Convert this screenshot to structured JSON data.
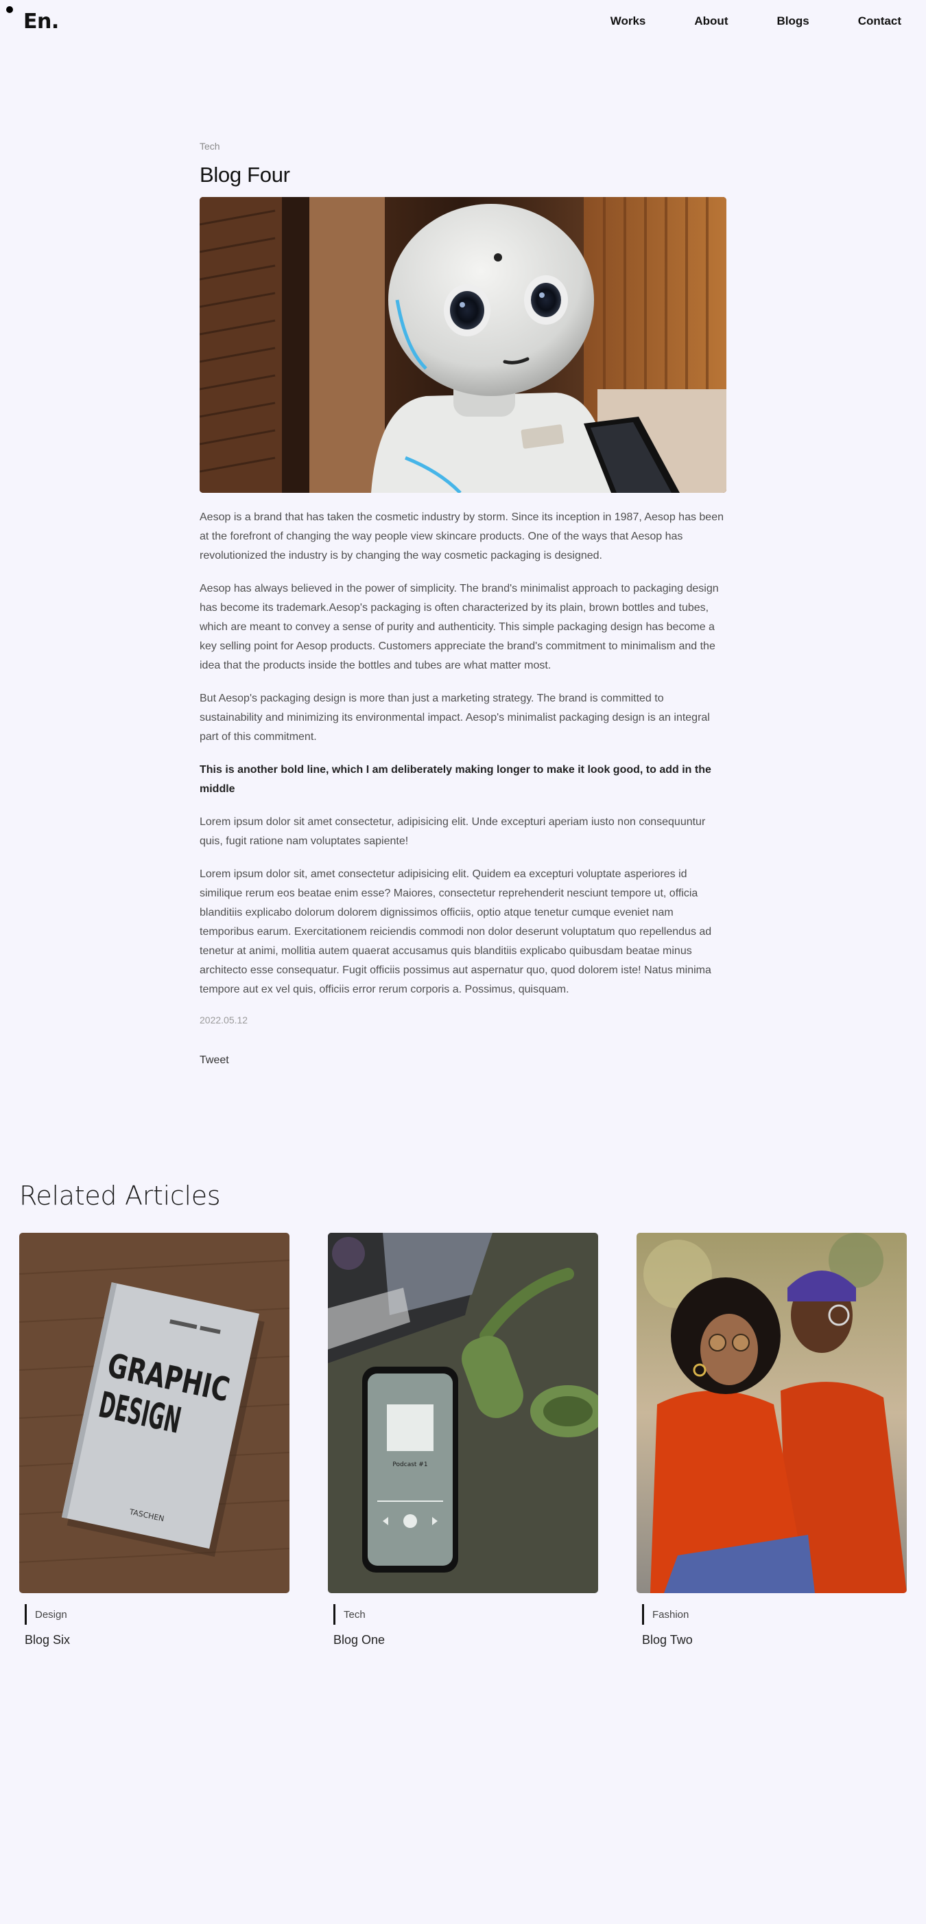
{
  "nav": {
    "logo": "En.",
    "links": [
      "Works",
      "About",
      "Blogs",
      "Contact"
    ]
  },
  "post": {
    "category": "Tech",
    "title": "Blog Four",
    "paragraphs": [
      "Aesop is a brand that has taken the cosmetic industry by storm. Since its inception in 1987, Aesop has been at the forefront of changing the way people view skincare products. One of the ways that Aesop has revolutionized the industry is by changing the way cosmetic packaging is designed.",
      "Aesop has always believed in the power of simplicity. The brand's minimalist approach to packaging design has become its trademark.Aesop's packaging is often characterized by its plain, brown bottles and tubes, which are meant to convey a sense of purity and authenticity. This simple packaging design has become a key selling point for Aesop products. Customers appreciate the brand's commitment to minimalism and the idea that the products inside the bottles and tubes are what matter most.",
      "But Aesop's packaging design is more than just a marketing strategy. The brand is committed to sustainability and minimizing its environmental impact. Aesop's minimalist packaging design is an integral part of this commitment.",
      "This is another bold line, which I am deliberately making longer to make it look good, to add in the middle",
      "Lorem ipsum dolor sit amet consectetur, adipisicing elit. Unde excepturi aperiam iusto non consequuntur quis, fugit ratione nam voluptates sapiente!",
      "Lorem ipsum dolor sit, amet consectetur adipisicing elit. Quidem ea excepturi voluptate asperiores id similique rerum eos beatae enim esse? Maiores, consectetur reprehenderit nesciunt tempore ut, officia blanditiis explicabo dolorum dolorem dignissimos officiis, optio atque tenetur cumque eveniet nam temporibus earum. Exercitationem reiciendis commodi non dolor deserunt voluptatum quo repellendus ad tenetur at animi, mollitia autem quaerat accusamus quis blanditiis explicabo quibusdam beatae minus architecto esse consequatur. Fugit officiis possimus aut aspernatur quo, quod dolorem iste! Natus minima tempore aut ex vel quis, officiis error rerum corporis a. Possimus, quisquam."
    ],
    "date": "2022.05.12",
    "tweet": "Tweet"
  },
  "related": {
    "title": "Related Articles",
    "cards": [
      {
        "category": "Design",
        "title": "Blog Six"
      },
      {
        "category": "Tech",
        "title": "Blog One"
      },
      {
        "category": "Fashion",
        "title": "Blog Two"
      }
    ],
    "book_cover_text": [
      "GRAPHIC",
      "DESIGN",
      "TASCHEN"
    ],
    "phone_screen_text": [
      "Podcast #1"
    ]
  },
  "colors": {
    "background": "#f6f5fd",
    "text": "#111111",
    "muted": "#8a8a8a"
  }
}
